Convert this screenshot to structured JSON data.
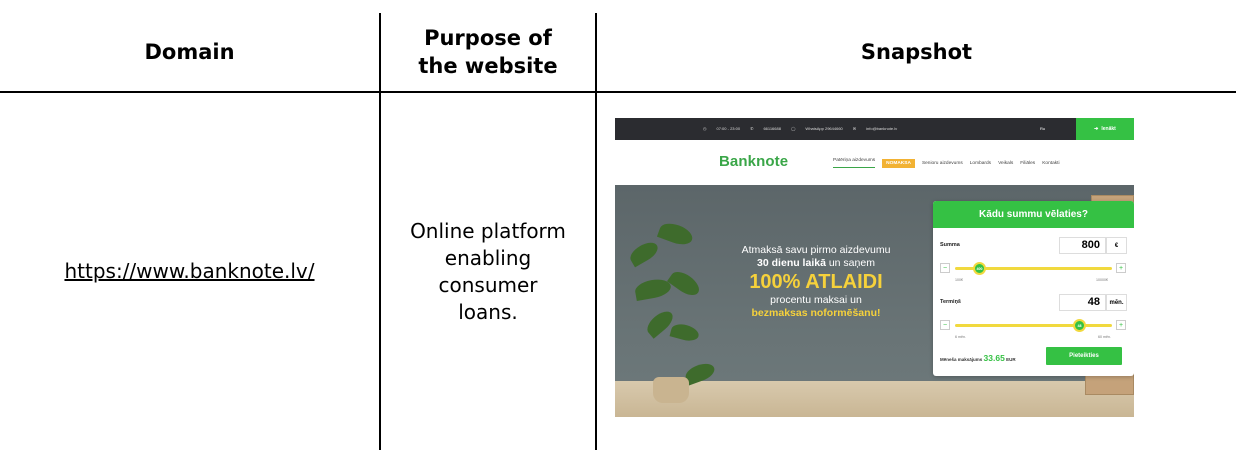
{
  "table": {
    "headers": [
      "Domain",
      "Purpose of the website",
      "Snapshot"
    ],
    "header_lines": {
      "domain": "Domain",
      "purpose_1": "Purpose of",
      "purpose_2": "the website",
      "snapshot": "Snapshot"
    },
    "row": {
      "domain": "https://www.banknote.lv/",
      "purpose_lines": [
        "Online platform",
        "enabling",
        "consumer",
        "loans."
      ]
    }
  },
  "snapshot": {
    "topbar": {
      "hours": "07:00 - 23:00",
      "phone": "66116688",
      "whatsapp": "WhatsApp 29644660",
      "email": "info@banknote.lv",
      "lang": "Ru",
      "login_label": "Ienākt"
    },
    "brand": "Banknote",
    "menu": {
      "consumer": "Patēriņa aizdevums",
      "badge": "NOMAKSA",
      "senior": "Senioru aizdevums",
      "pawnshop": "Lombards",
      "shops": "Veikals",
      "branches": "Filiāles",
      "contacts": "Kontakti"
    },
    "promo": {
      "line1": "Atmaksā savu pirmo aizdevumu",
      "line2_bold": "30 dienu laikā",
      "line2_rest": " un saņem",
      "big": "100% ATLAIDI",
      "line4": "procentu maksai un",
      "line5": "bezmaksas noformēšanu!"
    },
    "calculator": {
      "title": "Kādu summu vēlaties?",
      "amount_label": "Summa",
      "amount_value": "800",
      "amount_unit": "€",
      "amount_knob": "400",
      "amount_min": "100€",
      "amount_max": "10000€",
      "term_label": "Termiņš",
      "term_value": "48",
      "term_unit": "mēn.",
      "term_knob": "48",
      "term_min": "6 mēn.",
      "term_max": "60 mēn.",
      "monthly_label": "Mēneša maksājums",
      "monthly_amount": "33.65",
      "monthly_currency": "EUR",
      "apply_label": "Pieteikties",
      "minus": "−",
      "plus": "+"
    }
  }
}
